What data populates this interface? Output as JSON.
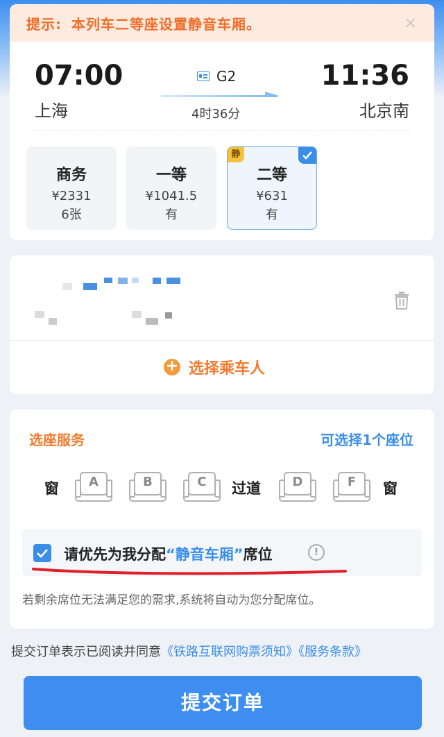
{
  "notice": {
    "label": "提示:",
    "text": "本列车二等座设置静音车厢。",
    "close": "×"
  },
  "trip": {
    "depart_time": "07:00",
    "depart_station": "上海",
    "train_no": "G2",
    "duration": "4时36分",
    "arrive_time": "11:36",
    "arrive_station": "北京南"
  },
  "seat_classes": [
    {
      "name": "商务",
      "price": "¥2331",
      "availability": "6张"
    },
    {
      "name": "一等",
      "price": "¥1041.5",
      "availability": "有"
    },
    {
      "name": "二等",
      "price": "¥631",
      "availability": "有",
      "badge": "静",
      "selected": true
    }
  ],
  "passenger": {
    "add_label": "选择乘车人",
    "add_icon": "+"
  },
  "seat_service": {
    "title": "选座服务",
    "count_hint": "可选择1个座位",
    "row": {
      "window_left": "窗",
      "seats_left": [
        "A",
        "B",
        "C"
      ],
      "aisle": "过道",
      "seats_right": [
        "D",
        "F"
      ],
      "window_right": "窗"
    },
    "prefer_prefix": "请优先为我分配",
    "prefer_highlight": "“静音车厢”",
    "prefer_suffix": "席位",
    "info_icon": "!",
    "note": "若剩余席位无法满足您的需求,系统将自动为您分配席位。"
  },
  "agreement": {
    "text": "提交订单表示已阅读并同意",
    "link1": "《铁路互联网购票须知》",
    "link2": "《服务条款》"
  },
  "submit_label": "提交订单",
  "colors": {
    "accent": "#3b8ee8",
    "warning": "#f07a2e",
    "notice_bg": "#fdebe0",
    "quiet_badge": "#f4c23a"
  }
}
